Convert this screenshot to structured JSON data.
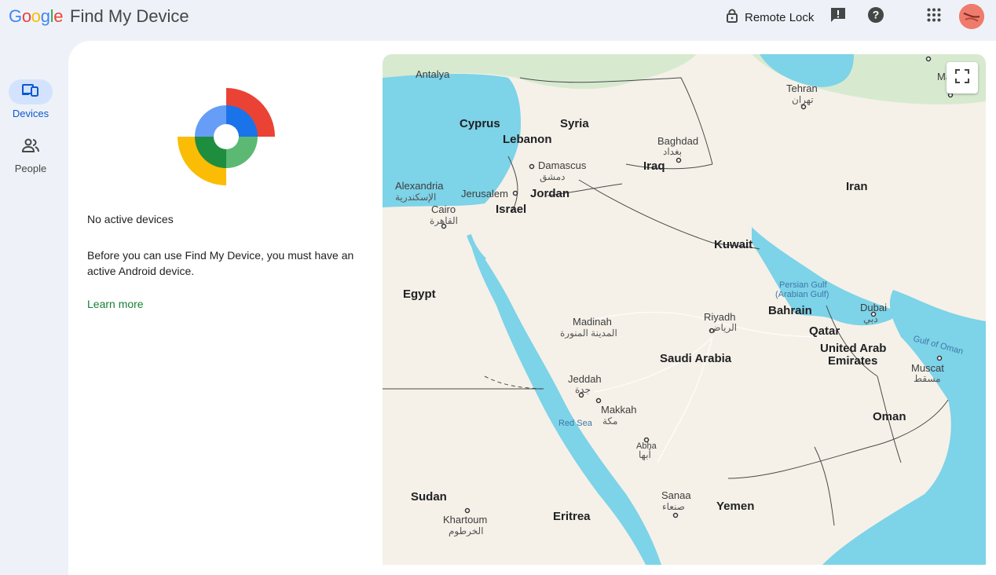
{
  "header": {
    "google_word": [
      "G",
      "o",
      "o",
      "g",
      "l",
      "e"
    ],
    "app_title": "Find My Device",
    "remote_lock_label": "Remote Lock",
    "icons": [
      "lock-icon",
      "feedback-icon",
      "help-icon",
      "apps-grid-icon",
      "account-avatar"
    ]
  },
  "rail": {
    "items": [
      {
        "label": "Devices",
        "icon": "devices-icon",
        "active": true
      },
      {
        "label": "People",
        "icon": "people-icon",
        "active": false
      }
    ]
  },
  "status": {
    "title": "No active devices",
    "description": "Before you can use Find My Device, you must have an active Android device.",
    "learn_more": "Learn more"
  },
  "map": {
    "countries": [
      "Cyprus",
      "Syria",
      "Lebanon",
      "Iraq",
      "Jordan",
      "Israel",
      "Iran",
      "Kuwait",
      "Egypt",
      "Bahrain",
      "Qatar",
      "Saudi Arabia",
      "United Arab",
      "Emirates",
      "Oman",
      "Sudan",
      "Yemen",
      "Eritrea"
    ],
    "cities": [
      {
        "en": "Antalya",
        "ar": ""
      },
      {
        "en": "Tehran",
        "ar": "تهران"
      },
      {
        "en": "Baghdad",
        "ar": "بغداد"
      },
      {
        "en": "Damascus",
        "ar": "دمشق"
      },
      {
        "en": "Alexandria",
        "ar": "الإسكندرية"
      },
      {
        "en": "Jerusalem",
        "ar": ""
      },
      {
        "en": "Cairo",
        "ar": "القاهرة"
      },
      {
        "en": "Riyadh",
        "ar": "الرياض"
      },
      {
        "en": "Madinah",
        "ar": "المدينة المنورة"
      },
      {
        "en": "Dubai",
        "ar": "دبي"
      },
      {
        "en": "Jeddah",
        "ar": "جدة"
      },
      {
        "en": "Makkah",
        "ar": "مكة"
      },
      {
        "en": "Muscat",
        "ar": "مسقط"
      },
      {
        "en": "Abha",
        "ar": "أبها"
      },
      {
        "en": "Sanaa",
        "ar": "صنعاء"
      },
      {
        "en": "Khartoum",
        "ar": "الخرطوم"
      },
      {
        "en": "Mas",
        "ar": ""
      }
    ],
    "water": [
      "Persian Gulf",
      "(Arabian Gulf)",
      "Gulf of Oman",
      "Red Sea"
    ],
    "colors": {
      "land": "#f5f1e8",
      "water": "#7dd3e8",
      "border": "#4a4a4a",
      "green": "#c8e6c0"
    }
  },
  "colors": {
    "accent": "#0b57d0",
    "link": "#188038",
    "rail_active": "#d3e3fd"
  }
}
